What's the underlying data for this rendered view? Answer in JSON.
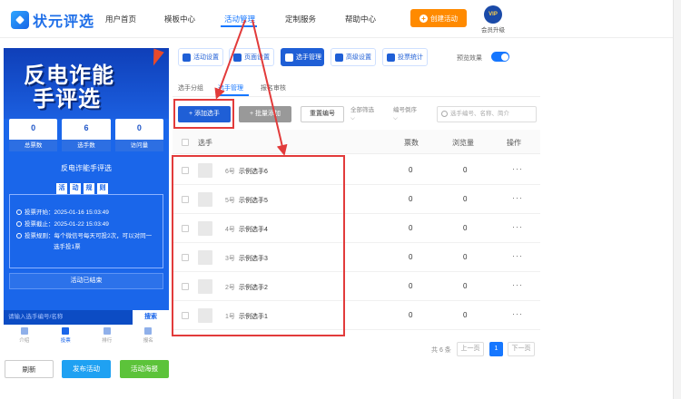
{
  "app": {
    "logo_text": "状元评选"
  },
  "nav": {
    "items": [
      "用户首页",
      "模板中心",
      "活动管理",
      "定制服务",
      "帮助中心"
    ],
    "active_index": 2
  },
  "header": {
    "create_button": "创建活动",
    "vip_badge": "VIP",
    "vip_label": "会员升级"
  },
  "preview": {
    "banner_line1": "反电诈能",
    "banner_line2": "手评选",
    "stats": [
      {
        "value": "0",
        "label": "总票数"
      },
      {
        "value": "6",
        "label": "选手数"
      },
      {
        "value": "0",
        "label": "访问量"
      }
    ],
    "activity_name": "反电诈能手评选",
    "rules_chars": [
      "活",
      "动",
      "规",
      "则"
    ],
    "rules": {
      "start": "投票开始：2025-01-16 15:03:49",
      "end": "投票截止：2025-01-22 15:03:49",
      "rule_line1": "投票规则：每个微信号每天可投2次，可以对同一",
      "rule_line2": "选手投1票"
    },
    "ended_label": "活动已结束",
    "search_placeholder": "请输入选手编号/名称",
    "search_button": "搜索",
    "tabbar": [
      "介绍",
      "投票",
      "排行",
      "报名"
    ],
    "tabbar_active": 1
  },
  "bottom_buttons": {
    "refresh": "刷新",
    "publish": "发布活动",
    "poster": "活动海报"
  },
  "toolbar": {
    "buttons": [
      "活动设置",
      "页面设置",
      "选手管理",
      "高级设置",
      "投票统计"
    ],
    "active_index": 2,
    "preview_label": "预览效果",
    "preview_on": true
  },
  "subtabs": {
    "items": [
      "选手分组",
      "选手管理",
      "报名审核"
    ],
    "active_index": 1
  },
  "actions": {
    "add_player": "+ 添加选手",
    "batch_add": "+ 批量添加",
    "renumber": "重置编号",
    "filter_all": "全部筛选",
    "sort_label": "编号倒序",
    "search_placeholder": "选手编号、名称、简介"
  },
  "table": {
    "headers": {
      "player": "选手",
      "votes": "票数",
      "views": "浏览量",
      "ops": "操作"
    },
    "rows": [
      {
        "num": "6号",
        "name": "示例选手6",
        "votes": "0",
        "views": "0",
        "ops": "···"
      },
      {
        "num": "5号",
        "name": "示例选手5",
        "votes": "0",
        "views": "0",
        "ops": "···"
      },
      {
        "num": "4号",
        "name": "示例选手4",
        "votes": "0",
        "views": "0",
        "ops": "···"
      },
      {
        "num": "3号",
        "name": "示例选手3",
        "votes": "0",
        "views": "0",
        "ops": "···"
      },
      {
        "num": "2号",
        "name": "示例选手2",
        "votes": "0",
        "views": "0",
        "ops": "···"
      },
      {
        "num": "1号",
        "name": "示例选手1",
        "votes": "0",
        "views": "0",
        "ops": "···"
      }
    ]
  },
  "pager": {
    "total": "共 6 条",
    "prev": "上一页",
    "current": "1",
    "next": "下一页"
  },
  "colors": {
    "primary": "#1f5fd6",
    "accent_orange": "#ff8a00",
    "annotation_red": "#e23b3b"
  }
}
